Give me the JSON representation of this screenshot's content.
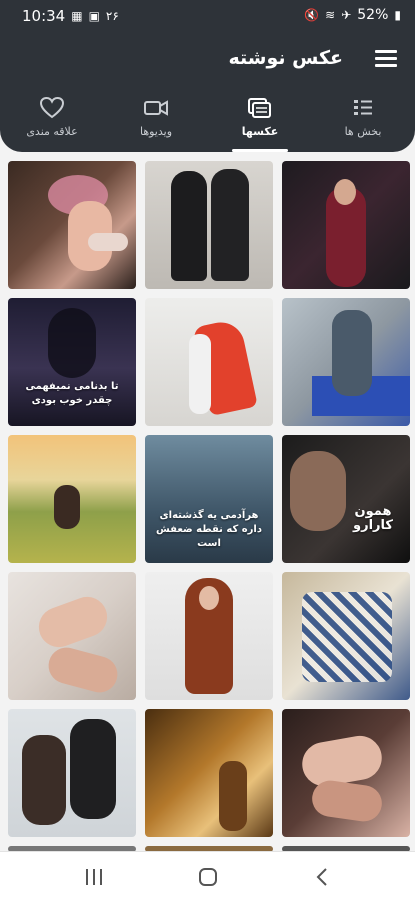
{
  "status_bar": {
    "time": "10:34",
    "notification_count": "۲۶",
    "battery": "52%"
  },
  "header": {
    "title": "عکس نوشته"
  },
  "tabs": [
    {
      "label": "علاقه مندی",
      "icon": "heart-icon"
    },
    {
      "label": "ویدیوها",
      "icon": "video-icon"
    },
    {
      "label": "عکسها",
      "icon": "images-icon",
      "active": true
    },
    {
      "label": "بخش ها",
      "icon": "list-icon"
    }
  ],
  "tiles": [
    {
      "overlay": ""
    },
    {
      "overlay": ""
    },
    {
      "overlay": ""
    },
    {
      "overlay": "تا بدنامی نمیفهمی چقدر خوب بودی"
    },
    {
      "overlay": ""
    },
    {
      "overlay": ""
    },
    {
      "overlay": ""
    },
    {
      "overlay": "هرآدمی یه گذشته‌ای داره که نقطه ضعفش است"
    },
    {
      "overlay": "همون کارارو"
    },
    {
      "overlay": ""
    },
    {
      "overlay": ""
    },
    {
      "overlay": ""
    },
    {
      "overlay": ""
    },
    {
      "overlay": ""
    },
    {
      "overlay": ""
    }
  ],
  "colors": {
    "header_bg": "#2e3339",
    "page_bg": "#f3f3f3"
  }
}
